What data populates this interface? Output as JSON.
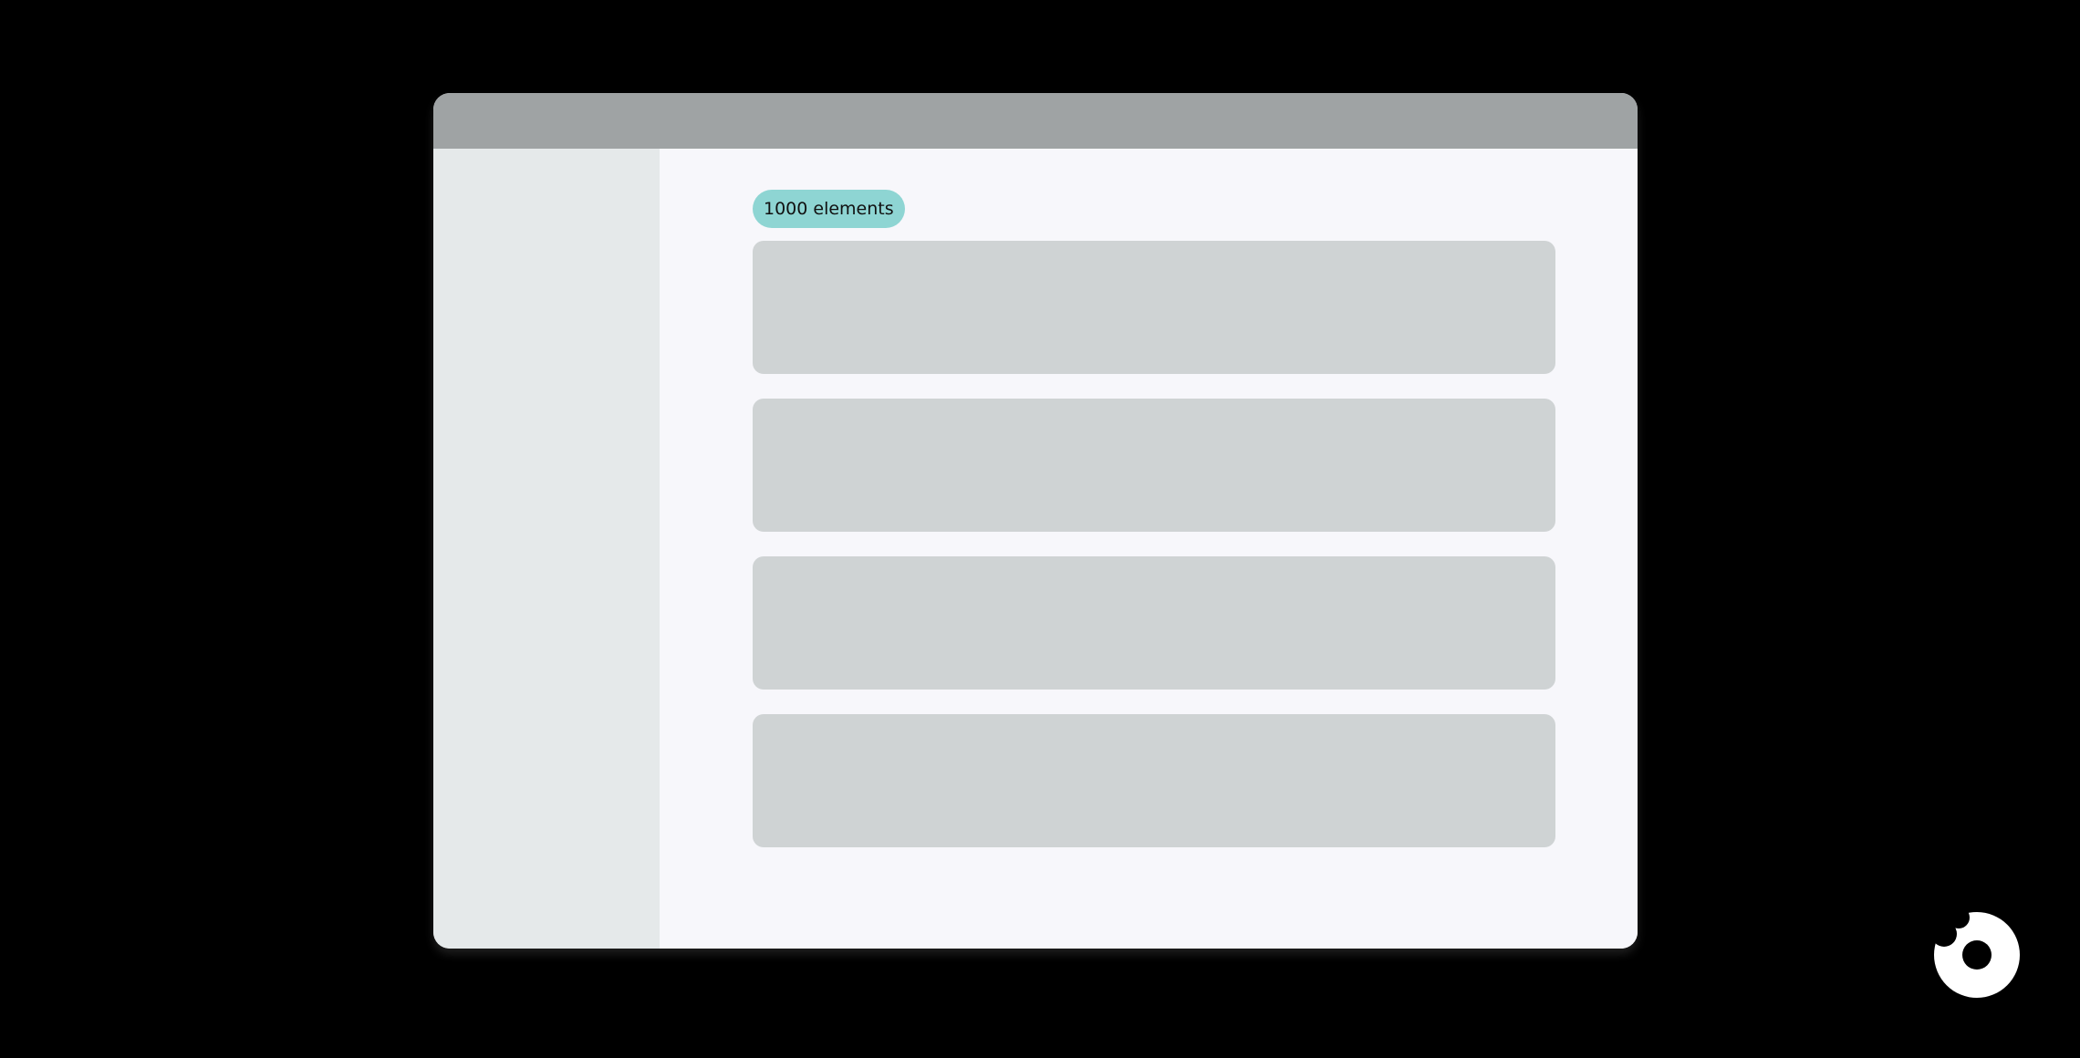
{
  "badge": {
    "text": "1000 elements"
  },
  "cards": [
    {},
    {},
    {},
    {}
  ],
  "colors": {
    "page_background": "#000000",
    "titlebar": "#9fa3a4",
    "sidebar": "#e5e9ea",
    "content": "#f7f7fb",
    "card": "#cfd3d4",
    "badge": "#8ed5d3",
    "logo": "#ffffff"
  },
  "icons": {
    "brand_logo": "donut-logo-icon"
  }
}
